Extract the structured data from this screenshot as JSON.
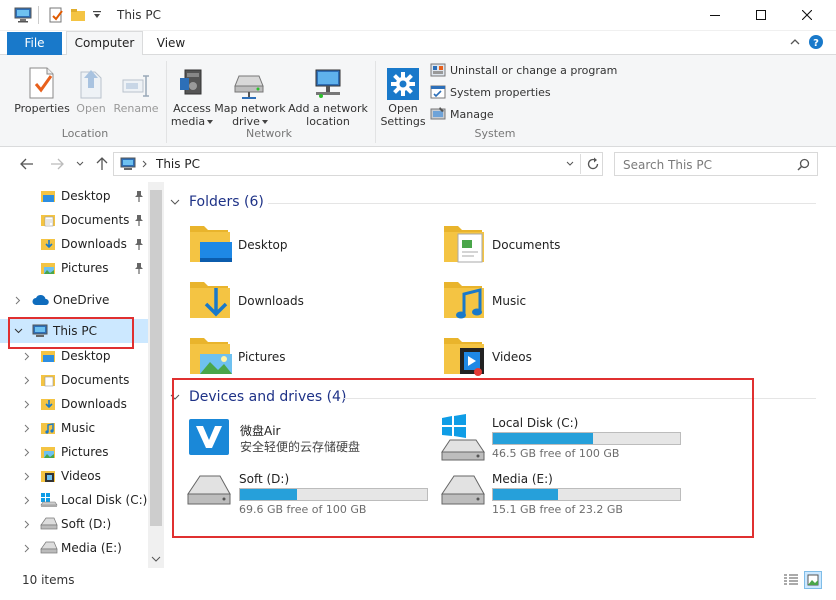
{
  "window": {
    "title": "This PC"
  },
  "tabs": {
    "file": "File",
    "computer": "Computer",
    "view": "View"
  },
  "ribbon": {
    "location": {
      "group_label": "Location",
      "properties": "Properties",
      "open": "Open",
      "rename": "Rename"
    },
    "network": {
      "group_label": "Network",
      "access_media_l1": "Access",
      "access_media_l2": "media",
      "map_drive_l1": "Map network",
      "map_drive_l2": "drive",
      "add_location_l1": "Add a network",
      "add_location_l2": "location"
    },
    "system": {
      "group_label": "System",
      "open_settings_l1": "Open",
      "open_settings_l2": "Settings",
      "uninstall": "Uninstall or change a program",
      "system_properties": "System properties",
      "manage": "Manage"
    }
  },
  "address": {
    "path": "This PC",
    "search_placeholder": "Search This PC"
  },
  "nav": {
    "quick_access": [
      "Desktop",
      "Documents",
      "Downloads",
      "Pictures"
    ],
    "onedrive": "OneDrive",
    "this_pc": "This PC",
    "this_pc_children": [
      "Desktop",
      "Documents",
      "Downloads",
      "Music",
      "Pictures",
      "Videos",
      "Local Disk (C:)",
      "Soft (D:)",
      "Media (E:)"
    ]
  },
  "content": {
    "folders_header": "Folders (6)",
    "folders": [
      "Desktop",
      "Documents",
      "Downloads",
      "Music",
      "Pictures",
      "Videos"
    ],
    "devices_header": "Devices and drives (4)",
    "weipan": {
      "name": "微盘Air",
      "desc": "安全轻便的云存储硬盘"
    },
    "drives": [
      {
        "name": "Local Disk (C:)",
        "free": "46.5 GB free of 100 GB",
        "used_fraction": 0.535
      },
      {
        "name": "Soft (D:)",
        "free": "69.6 GB free of 100 GB",
        "used_fraction": 0.304
      },
      {
        "name": "Media (E:)",
        "free": "15.1 GB free of 23.2 GB",
        "used_fraction": 0.349
      }
    ]
  },
  "status": {
    "items": "10 items"
  },
  "colors": {
    "accent": "#1979ca",
    "bar_fill": "#26a0da",
    "highlight_box": "#e03030",
    "folder": "#f4c443"
  }
}
